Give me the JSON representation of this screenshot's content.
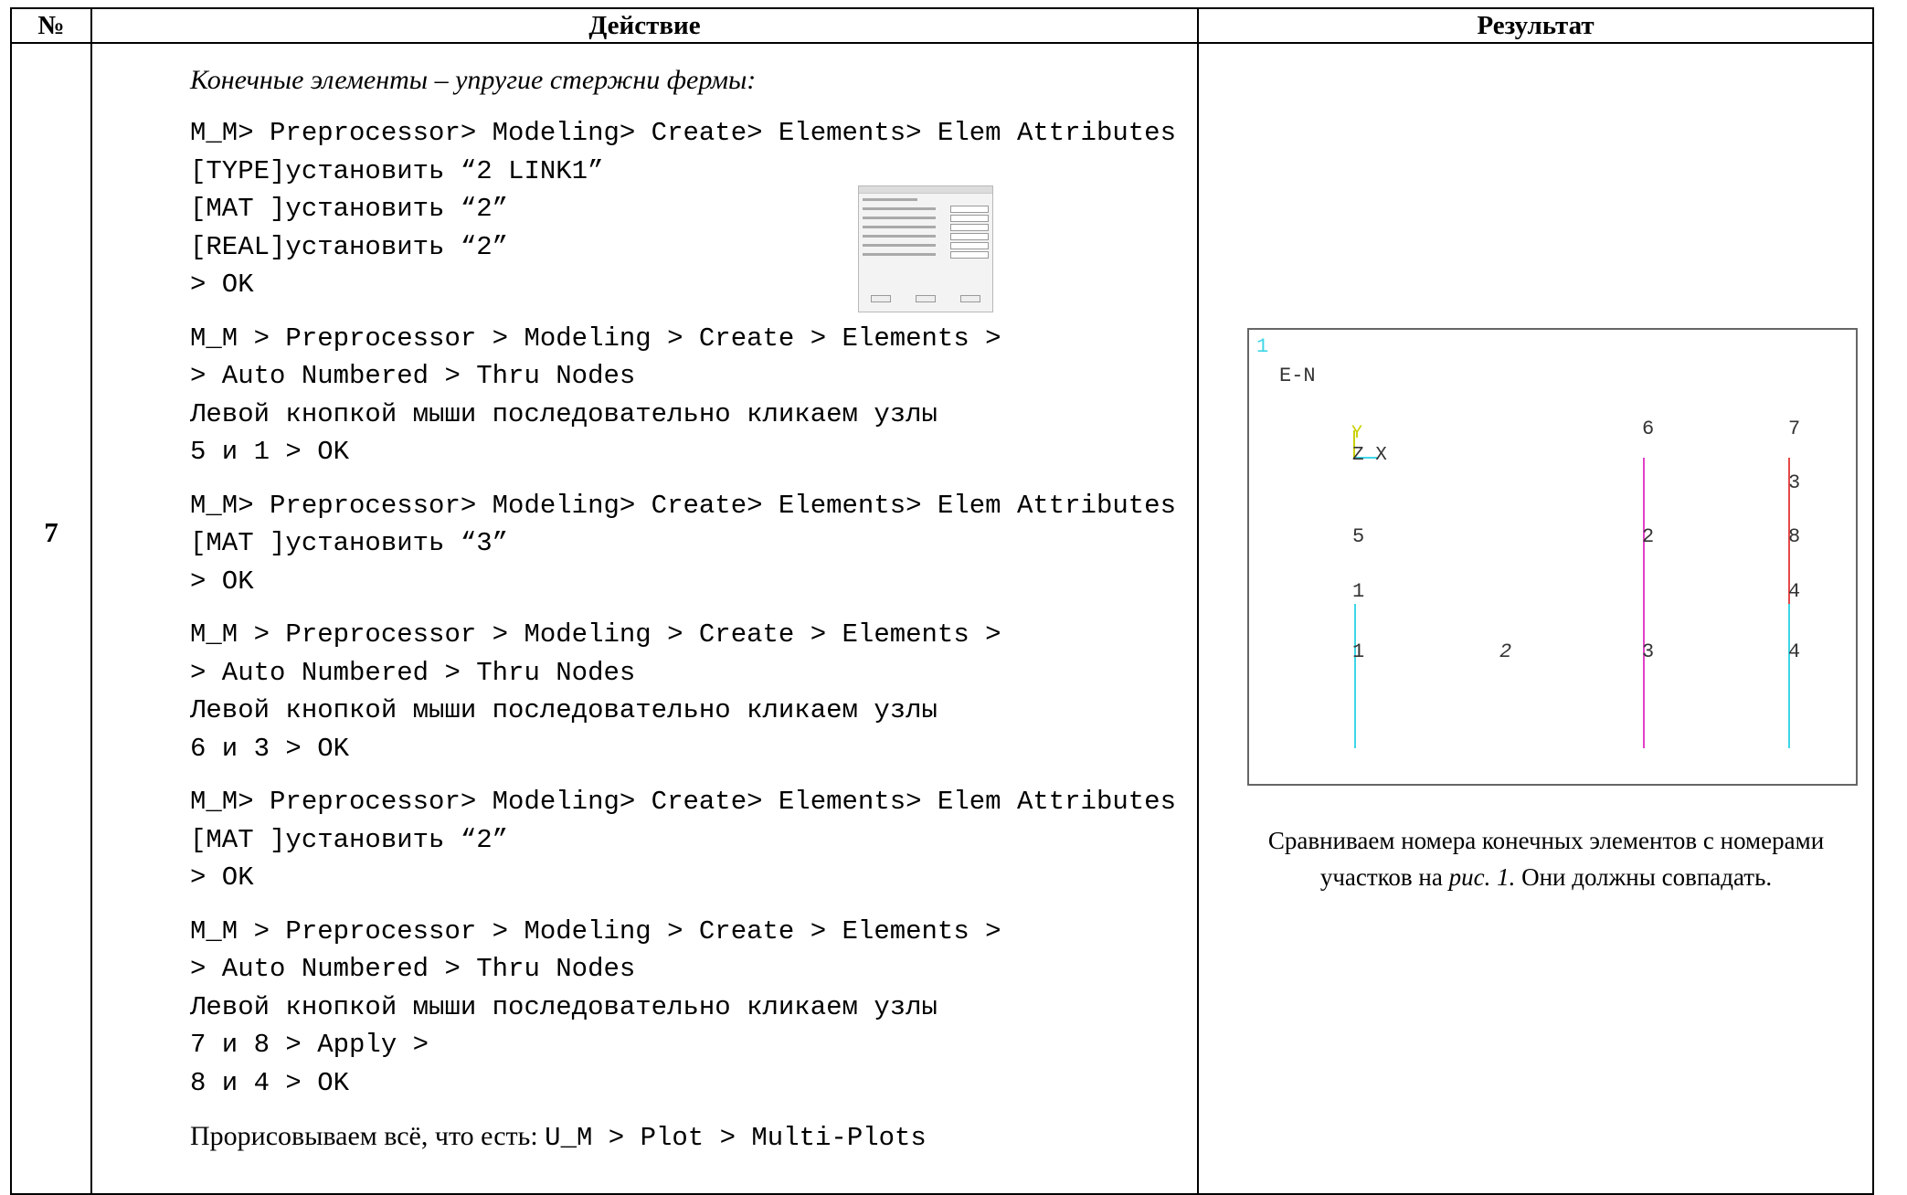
{
  "header": {
    "col_num": "№",
    "col_action": "Действие",
    "col_result": "Результат"
  },
  "row": {
    "num": "7",
    "intro": "Конечные элементы – упругие стержни фермы:",
    "block1": [
      "M_M> Preprocessor> Modeling> Create> Elements> Elem Attributes",
      "[TYPE]установить “2 LINK1”",
      "[MAT ]установить “2”",
      "[REAL]установить “2”",
      "> OK"
    ],
    "block2": [
      "M_M > Preprocessor > Modeling > Create > Elements >",
      "> Auto Numbered > Thru Nodes",
      "Левой кнопкой мыши последовательно кликаем узлы",
      "5 и 1 > OK"
    ],
    "block3": [
      "M_M> Preprocessor> Modeling> Create> Elements> Elem Attributes",
      "[MAT ]установить “3”",
      "> OK"
    ],
    "block4": [
      "M_M > Preprocessor > Modeling > Create > Elements >",
      "> Auto Numbered > Thru Nodes",
      "Левой кнопкой мыши последовательно кликаем узлы",
      "6 и 3 > OK"
    ],
    "block5": [
      "M_M> Preprocessor> Modeling> Create> Elements> Elem Attributes",
      "[MAT ]установить “2”",
      "> OK"
    ],
    "block6": [
      "M_M > Preprocessor > Modeling > Create > Elements >",
      "> Auto Numbered > Thru Nodes",
      "Левой кнопкой мыши последовательно кликаем узлы",
      "7 и 8 > Apply >",
      "8 и 4 > OK"
    ],
    "last_text": "Прорисовываем всё, что есть: ",
    "last_cmd": "U_M > Plot > Multi-Plots"
  },
  "plot": {
    "window_num": "1",
    "label": "E-N",
    "axis_y": "Y",
    "axis_zx": "Z X",
    "nodes": [
      "1",
      "2",
      "3",
      "4",
      "5",
      "6",
      "7",
      "8"
    ],
    "elements": [
      "1",
      "2",
      "3",
      "4"
    ],
    "colors": {
      "cyan": "#3fd6e6",
      "magenta": "#e040c8",
      "red": "#e54848",
      "yellow": "#c8d000",
      "text": "#333333"
    }
  },
  "caption": {
    "text_a": "Сравниваем номера конечных элементов с номерами участков на ",
    "text_ref": "рис. 1.",
    "text_b": " Они должны совпадать."
  }
}
